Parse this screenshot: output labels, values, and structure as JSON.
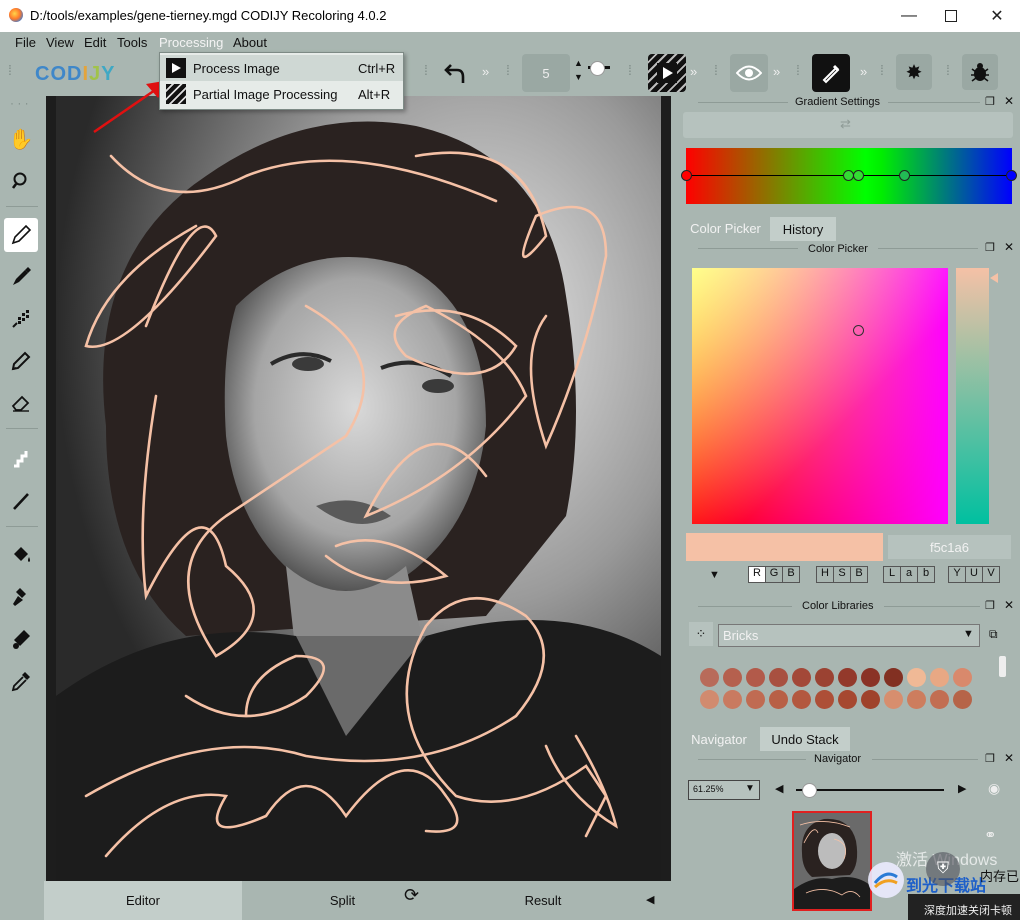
{
  "window": {
    "title": "D:/tools/examples/gene-tierney.mgd CODIJY Recoloring 4.0.2",
    "minimize_icon": "minimize-icon",
    "maximize_icon": "maximize-icon",
    "close_icon": "close-icon"
  },
  "menubar": {
    "items": [
      {
        "label": "File"
      },
      {
        "label": "View"
      },
      {
        "label": "Edit"
      },
      {
        "label": "Tools"
      },
      {
        "label": "Processing"
      },
      {
        "label": "About"
      }
    ]
  },
  "processing_menu": {
    "items": [
      {
        "label": "Process Image",
        "shortcut": "Ctrl+R",
        "icon": "play-icon"
      },
      {
        "label": "Partial Image Processing",
        "shortcut": "Alt+R",
        "icon": "partial-process-icon"
      }
    ]
  },
  "toolbar": {
    "logo": "CODIJY",
    "brush_size": "5",
    "icons": [
      "undo-icon",
      "brush-size-slider",
      "process-image-icon",
      "preview-eye-icon",
      "pen-mode-icon",
      "settings-gear-icon",
      "bug-report-icon"
    ]
  },
  "left_tools": [
    "hand-icon",
    "zoom-icon",
    "pencil-icon",
    "marker-icon",
    "spray-icon",
    "pen-icon",
    "eraser-icon",
    "line-tool-icon",
    "straight-line-icon",
    "fill-bucket-icon",
    "stamp-icon",
    "eyedropper-fill-icon",
    "eyedropper-icon"
  ],
  "gradient_panel": {
    "title": "Gradient Settings"
  },
  "color_picker_panel": {
    "tabs": [
      {
        "label": "Color Picker"
      },
      {
        "label": "History"
      }
    ],
    "title": "Color Picker",
    "hex_value": "f5c1a6",
    "current_color": "#f5c1a6",
    "modes": [
      {
        "letters": [
          "R",
          "G",
          "B"
        ]
      },
      {
        "letters": [
          "H",
          "S",
          "B"
        ]
      },
      {
        "letters": [
          "L",
          "a",
          "b"
        ]
      },
      {
        "letters": [
          "Y",
          "U",
          "V"
        ]
      }
    ]
  },
  "color_libraries_panel": {
    "title": "Color Libraries",
    "library_name": "Bricks",
    "swatches_row1": [
      "#b86b5a",
      "#b5604e",
      "#b25a4a",
      "#a85040",
      "#a34838",
      "#9b4232",
      "#93392b",
      "#8a3226",
      "#823022",
      "#f0b996",
      "#e8a884",
      "#d9896c"
    ],
    "swatches_row2": [
      "#d18b6f",
      "#c97a60",
      "#c06b52",
      "#b86046",
      "#b3583f",
      "#ad4f37",
      "#a64830",
      "#9f422b",
      "#d78e6e",
      "#cd7d5e",
      "#c26e52",
      "#b66448"
    ]
  },
  "navigator_panel": {
    "tabs": [
      {
        "label": "Navigator"
      },
      {
        "label": "Undo Stack"
      }
    ],
    "title": "Navigator",
    "zoom": "61.25%"
  },
  "bottom_tabs": [
    {
      "label": "Editor"
    },
    {
      "label": "Split"
    },
    {
      "label": "Result"
    }
  ],
  "watermark": {
    "text1": "激活 Windows",
    "text2": "到光下载站",
    "text3": "内存已",
    "text4": "深度加速关闭卡顿"
  }
}
